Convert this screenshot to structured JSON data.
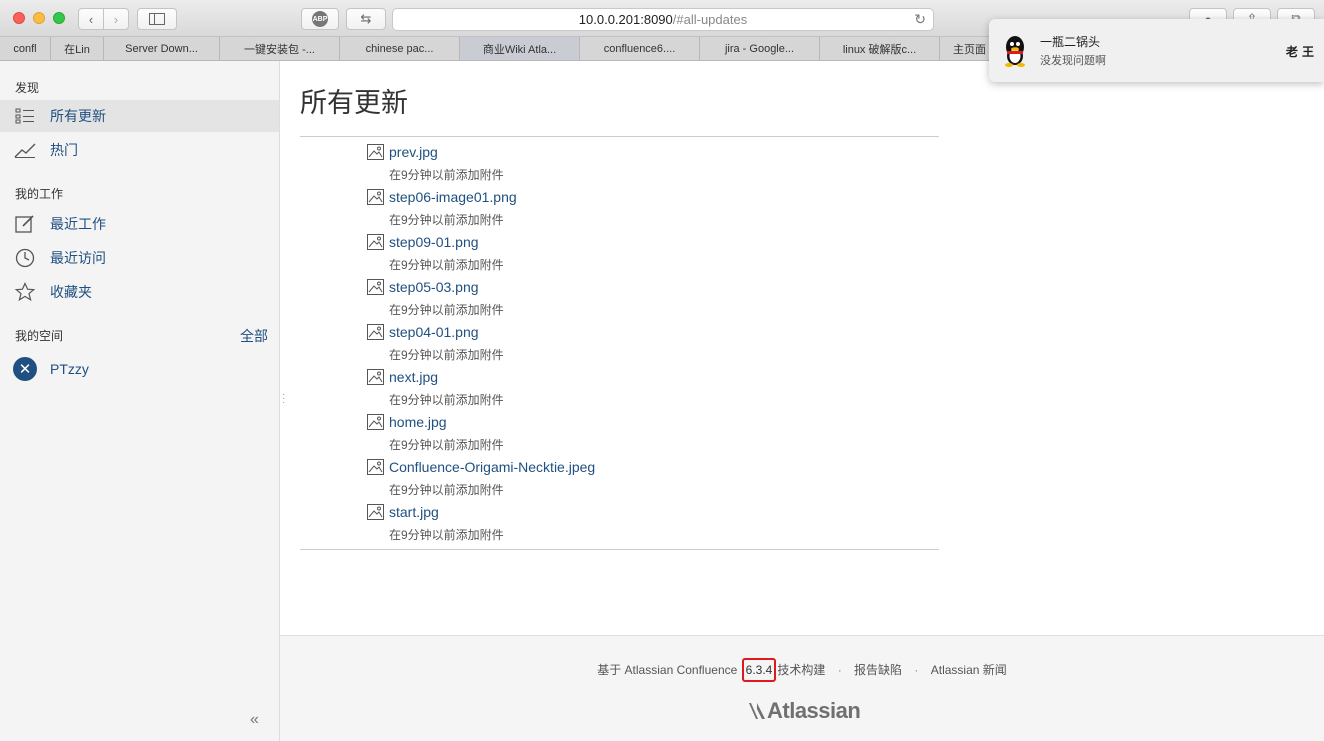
{
  "browser": {
    "url_host": "10.0.0.201:8090",
    "url_path": "/#all-updates",
    "abp_label": "ABP",
    "tabs": [
      {
        "label": "confl"
      },
      {
        "label": "在Lin"
      },
      {
        "label": "Server Down..."
      },
      {
        "label": "一键安装包 -..."
      },
      {
        "label": "chinese pac..."
      },
      {
        "label": "商业Wiki Atla..."
      },
      {
        "label": "confluence6...."
      },
      {
        "label": "jira - Google..."
      },
      {
        "label": "linux 破解版c..."
      },
      {
        "label": "主页面"
      }
    ]
  },
  "notification": {
    "title": "一瓶二锅头",
    "message": "没发现问题啊",
    "sender": "老 王"
  },
  "sidebar": {
    "discover_heading": "发现",
    "discover_items": [
      {
        "label": "所有更新",
        "icon": "list-icon"
      },
      {
        "label": "热门",
        "icon": "trending-icon"
      }
    ],
    "work_heading": "我的工作",
    "work_items": [
      {
        "label": "最近工作",
        "icon": "edit-icon"
      },
      {
        "label": "最近访问",
        "icon": "clock-icon"
      },
      {
        "label": "收藏夹",
        "icon": "star-icon"
      }
    ],
    "spaces_heading": "我的空间",
    "spaces_all": "全部",
    "spaces": [
      {
        "label": "PTzzy"
      }
    ],
    "collapse_glyph": "«"
  },
  "main": {
    "title": "所有更新",
    "updates": [
      {
        "file": "prev.jpg",
        "meta": "在9分钟以前添加附件"
      },
      {
        "file": "step06-image01.png",
        "meta": "在9分钟以前添加附件"
      },
      {
        "file": "step09-01.png",
        "meta": "在9分钟以前添加附件"
      },
      {
        "file": "step05-03.png",
        "meta": "在9分钟以前添加附件"
      },
      {
        "file": "step04-01.png",
        "meta": "在9分钟以前添加附件"
      },
      {
        "file": "next.jpg",
        "meta": "在9分钟以前添加附件"
      },
      {
        "file": "home.jpg",
        "meta": "在9分钟以前添加附件"
      },
      {
        "file": "Confluence-Origami-Necktie.jpeg",
        "meta": "在9分钟以前添加附件"
      },
      {
        "file": "start.jpg",
        "meta": "在9分钟以前添加附件"
      }
    ]
  },
  "footer": {
    "prefix": "基于 Atlassian Confluence",
    "version": "6.3.4",
    "suffix": "技术构建",
    "report_bug": "报告缺陷",
    "news": "Atlassian 新闻",
    "separator": "·",
    "logo_text": "Atlassian"
  },
  "colors": {
    "link": "#205081",
    "highlight_box": "#e0191f"
  }
}
